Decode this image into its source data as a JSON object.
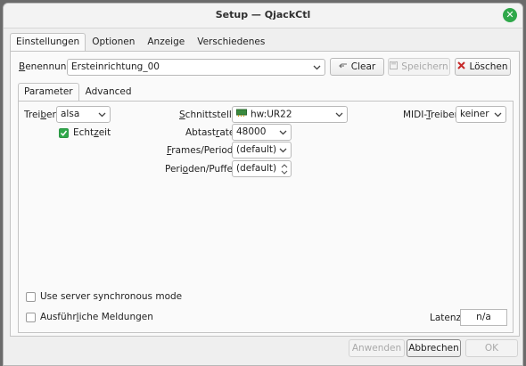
{
  "window": {
    "title": "Setup — QjackCtl"
  },
  "main_tabs": [
    "Einstellungen",
    "Optionen",
    "Anzeige",
    "Verschiedenes"
  ],
  "preset": {
    "label": "Benennung:",
    "value": "Ersteinrichtung_00",
    "clear_label": "Clear",
    "save_label": "Speichern",
    "delete_label": "Löschen"
  },
  "sub_tabs": [
    "Parameter",
    "Advanced"
  ],
  "params": {
    "driver_label": "Treiber:",
    "driver_value": "alsa",
    "realtime_label": "Echtzeit",
    "realtime_checked": true,
    "interface_label": "Schnittstelle:",
    "interface_value": "hw:UR22",
    "interface_icon": "sound-card-icon",
    "midi_label": "MIDI-Treiber:",
    "midi_value": "keiner",
    "samplerate_label": "Abtastrate:",
    "samplerate_value": "48000",
    "frames_label": "Frames/Periode:",
    "frames_value": "(default)",
    "periods_label": "Perioden/Puffer:",
    "periods_value": "(default)"
  },
  "options": {
    "sync_label": "Use server synchronous mode",
    "verbose_label": "Ausführliche Meldungen",
    "latency_label": "Latenz:",
    "latency_value": "n/a"
  },
  "footer": {
    "apply_label": "Anwenden",
    "cancel_label": "Abbrechen",
    "ok_label": "OK"
  },
  "colors": {
    "accent": "#2fa84a",
    "close": "#2fa84a",
    "delete_icon": "#c62828"
  }
}
